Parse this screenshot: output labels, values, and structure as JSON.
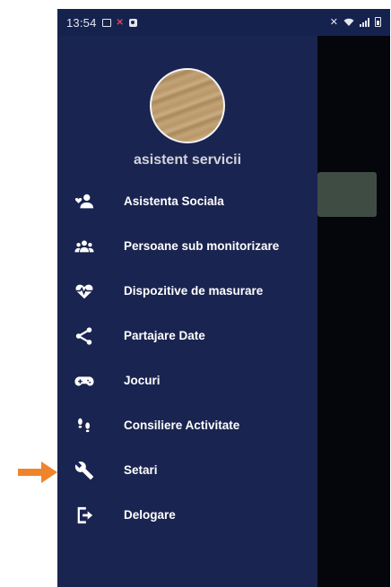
{
  "status_bar": {
    "time": "13:54",
    "left_icons": [
      "image-icon",
      "notification-x-icon",
      "app-square-icon"
    ],
    "right_icons": [
      "mute-icon",
      "wifi-icon",
      "signal-icon",
      "battery-icon"
    ]
  },
  "drawer": {
    "avatar": "avatar-photo",
    "username": "asistent servicii",
    "background_color": "#1a2450",
    "items": [
      {
        "label": "Asistenta Sociala",
        "icon": "people-heart-icon"
      },
      {
        "label": "Persoane sub monitorizare",
        "icon": "group-icon"
      },
      {
        "label": "Dispozitive de masurare",
        "icon": "heartbeat-icon"
      },
      {
        "label": "Partajare Date",
        "icon": "share-icon"
      },
      {
        "label": "Jocuri",
        "icon": "gamepad-icon"
      },
      {
        "label": "Consiliere Activitate",
        "icon": "footsteps-icon"
      },
      {
        "label": "Setari",
        "icon": "wrench-icon"
      },
      {
        "label": "Delogare",
        "icon": "logout-icon"
      }
    ]
  },
  "annotation": {
    "arrow": "orange-arrow",
    "color": "#f0842b"
  }
}
